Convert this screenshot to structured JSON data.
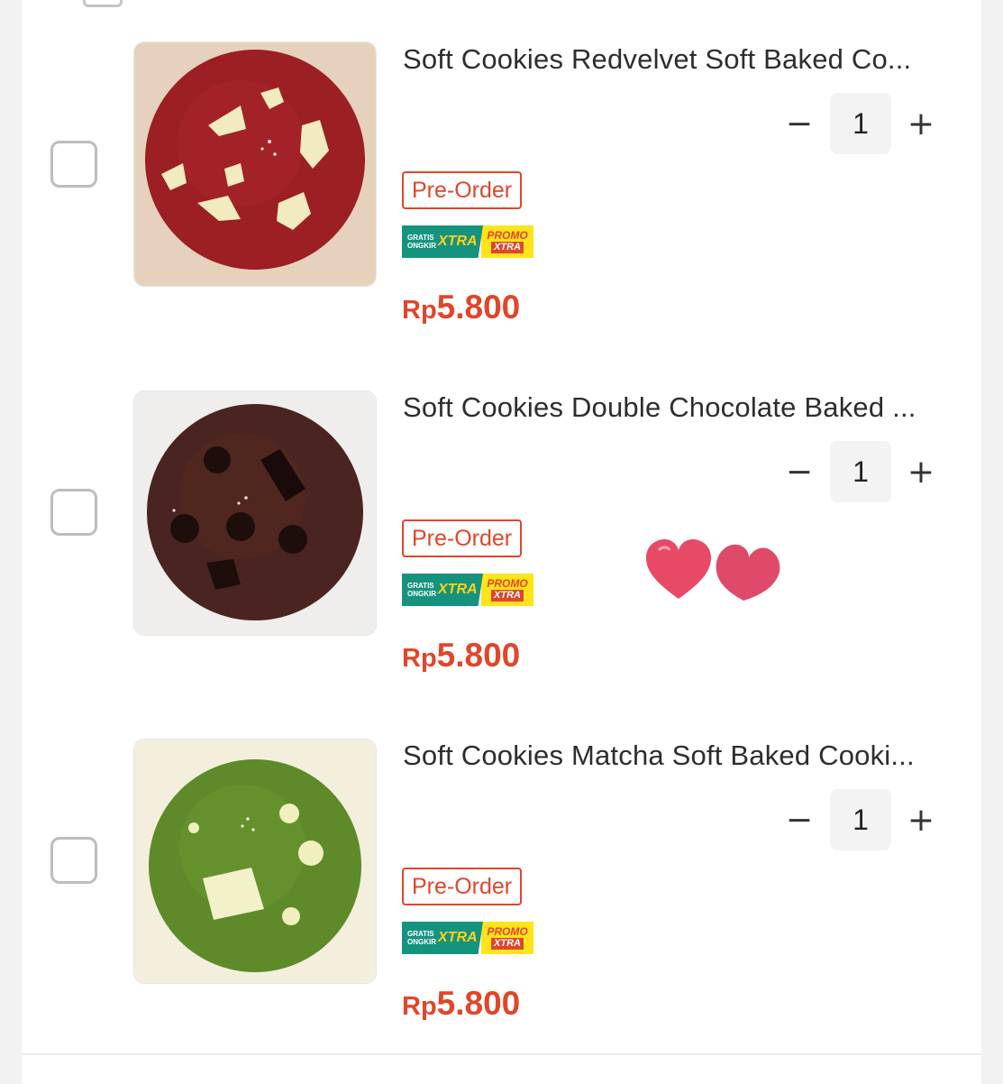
{
  "items": [
    {
      "title": "Soft Cookies Redvelvet Soft Baked Co...",
      "quantity": "1",
      "tag": "Pre-Order",
      "badge_ongkir_small": "GRATIS ONGKIR",
      "badge_ongkir_big": "XTRA",
      "badge_promo": "PROMO",
      "badge_promo_xtra": "XTRA",
      "price_currency": "Rp",
      "price_value": "5.800",
      "image_desc": "red-velvet-cookie"
    },
    {
      "title": "Soft Cookies Double Chocolate Baked ...",
      "quantity": "1",
      "tag": "Pre-Order",
      "badge_ongkir_small": "GRATIS ONGKIR",
      "badge_ongkir_big": "XTRA",
      "badge_promo": "PROMO",
      "badge_promo_xtra": "XTRA",
      "price_currency": "Rp",
      "price_value": "5.800",
      "image_desc": "double-chocolate-cookie"
    },
    {
      "title": "Soft Cookies Matcha Soft Baked Cooki...",
      "quantity": "1",
      "tag": "Pre-Order",
      "badge_ongkir_small": "GRATIS ONGKIR",
      "badge_ongkir_big": "XTRA",
      "badge_promo": "PROMO",
      "badge_promo_xtra": "XTRA",
      "price_currency": "Rp",
      "price_value": "5.800",
      "image_desc": "matcha-cookie"
    }
  ],
  "controls": {
    "minus": "−",
    "plus": "+"
  },
  "colors": {
    "accent": "#e0462a",
    "ongkir_green": "#16937f",
    "promo_yellow": "#ffe41a",
    "heart": "#e84a66"
  },
  "decoration": "two-hearts-sticker"
}
